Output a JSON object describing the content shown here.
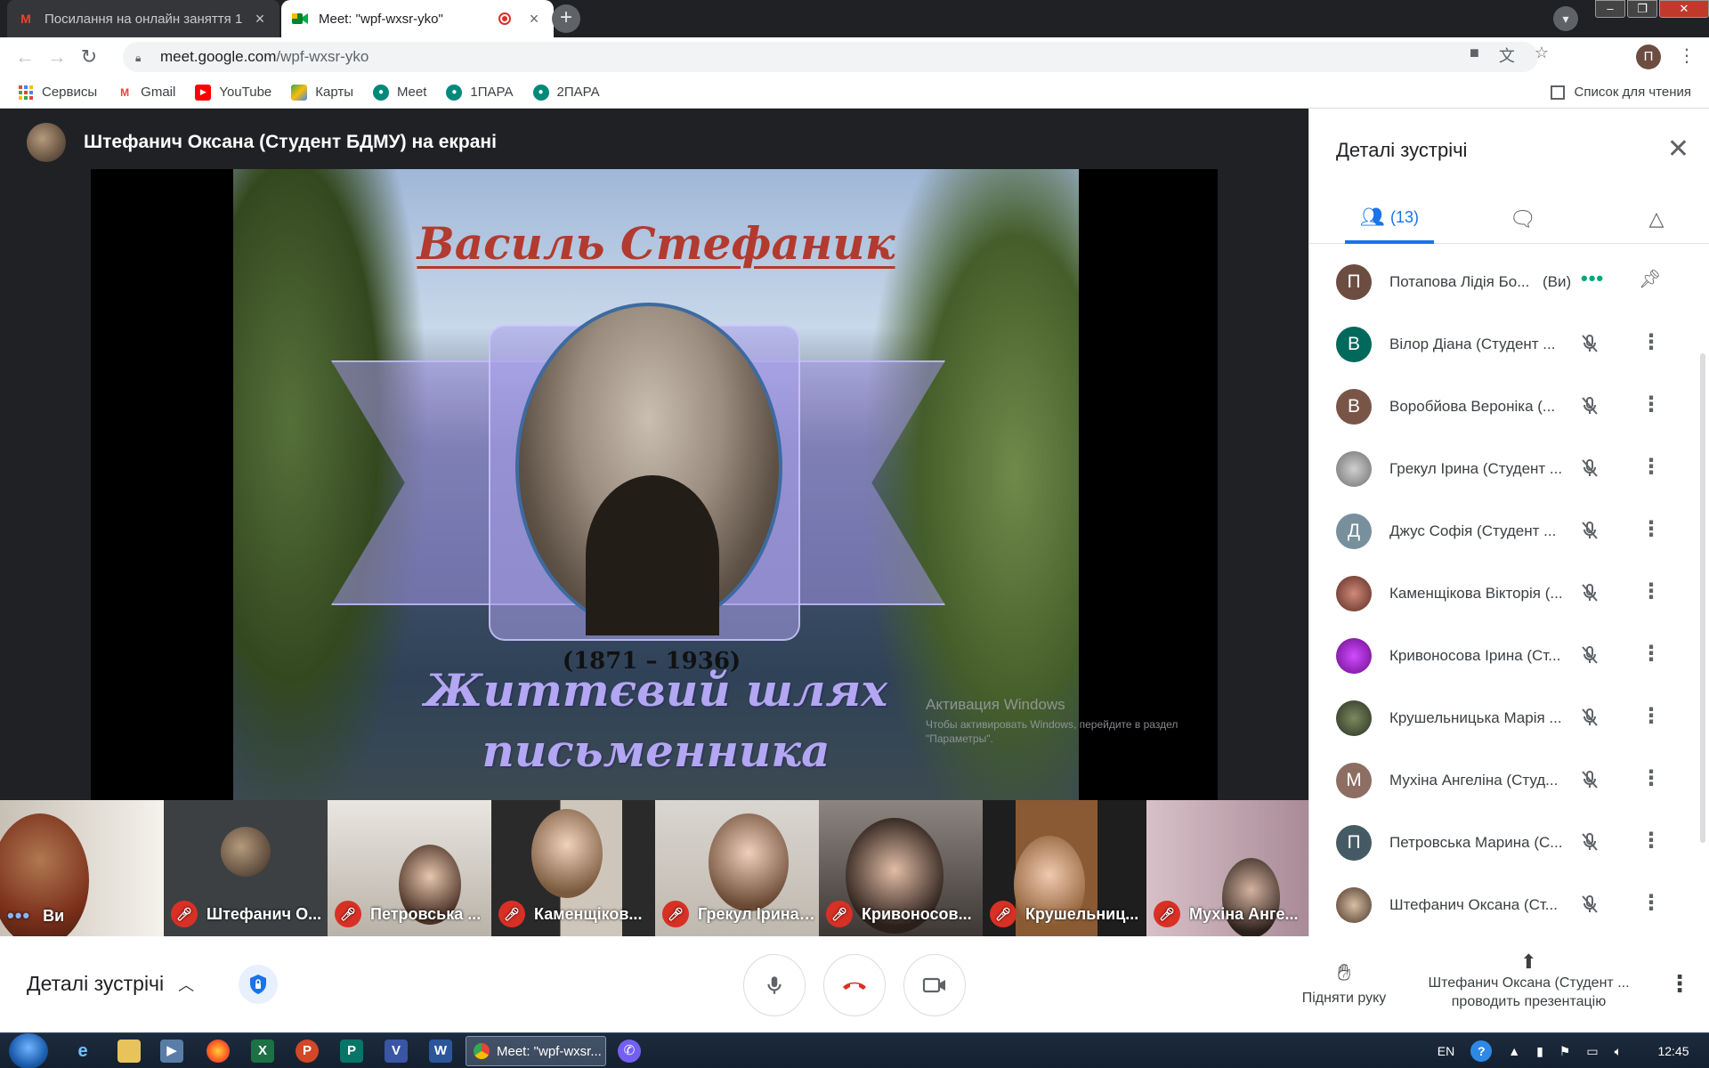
{
  "browser": {
    "tabs": [
      {
        "title": "Посилання на онлайн заняття 1",
        "active": false
      },
      {
        "title": "Meet: \"wpf-wxsr-yko\"",
        "active": true
      }
    ],
    "url_host": "meet.google.com",
    "url_path": "/wpf-wxsr-yko",
    "profile_initial": "П",
    "bookmarks": [
      {
        "label": "Сервисы",
        "icon": "apps-grid-icon"
      },
      {
        "label": "Gmail",
        "icon": "gmail-icon"
      },
      {
        "label": "YouTube",
        "icon": "youtube-icon"
      },
      {
        "label": "Карты",
        "icon": "maps-icon"
      },
      {
        "label": "Meet",
        "icon": "meet-icon"
      },
      {
        "label": "1ПАРА",
        "icon": "meet-icon"
      },
      {
        "label": "2ПАРА",
        "icon": "meet-icon"
      }
    ],
    "reading_list": "Список для чтения"
  },
  "stage": {
    "presenter_label": "Штефанич Оксана (Студент БДМУ) на екрані",
    "slide": {
      "title": "Василь Стефаник",
      "years": "(1871 – 1936)",
      "subtitle_line1": "Життєвий шлях",
      "subtitle_line2": "письменника"
    },
    "watermark_title": "Активация Windows",
    "watermark_text": "Чтобы активировать Windows, перейдите в раздел \"Параметры\"."
  },
  "filmstrip": [
    {
      "name": "Ви",
      "muted": false
    },
    {
      "name": "Штефанич О...",
      "muted": true
    },
    {
      "name": "Петровська ...",
      "muted": true
    },
    {
      "name": "Каменщіков...",
      "muted": true
    },
    {
      "name": "Грекул Ірина ...",
      "muted": true
    },
    {
      "name": "Кривоносов...",
      "muted": true
    },
    {
      "name": "Крушельниц...",
      "muted": true
    },
    {
      "name": "Мухіна Анге...",
      "muted": true
    }
  ],
  "panel": {
    "title": "Деталі зустрічі",
    "people_count": "(13)",
    "participants": [
      {
        "initial": "П",
        "name": "Потапова Лідія Бо...",
        "you": "(Ви)",
        "color": "#6d4c41"
      },
      {
        "initial": "В",
        "name": "Вілор Діана (Студент ...",
        "color": "#00695c"
      },
      {
        "initial": "В",
        "name": "Воробйова Вероніка (...",
        "color": "#795548"
      },
      {
        "initial": "",
        "name": "Грекул Ірина (Студент ...",
        "color": "#8d8d8d"
      },
      {
        "initial": "Д",
        "name": "Джус Софія (Студент ...",
        "color": "#78909c"
      },
      {
        "initial": "",
        "name": "Каменщікова Вікторія (...",
        "color": "#8d5a4a"
      },
      {
        "initial": "",
        "name": "Кривоносова Ірина (Ст...",
        "color": "#8e24aa"
      },
      {
        "initial": "",
        "name": "Крушельницька Марія ...",
        "color": "#4e5b3a"
      },
      {
        "initial": "М",
        "name": "Мухіна Ангеліна (Студ...",
        "color": "#8d6e63"
      },
      {
        "initial": "П",
        "name": "Петровська Марина (С...",
        "color": "#455a64"
      },
      {
        "initial": "",
        "name": "Штефанич Оксана (Ст...",
        "color": "#a1887f"
      }
    ]
  },
  "bottombar": {
    "meeting_details": "Деталі зустрічі",
    "raise_hand": "Підняти руку",
    "presenting_line1": "Штефанич Оксана (Студент ...",
    "presenting_line2": "проводить презентацію"
  },
  "taskbar": {
    "active_task": "Meet: \"wpf-wxsr...",
    "lang": "EN",
    "time": "12:45"
  }
}
